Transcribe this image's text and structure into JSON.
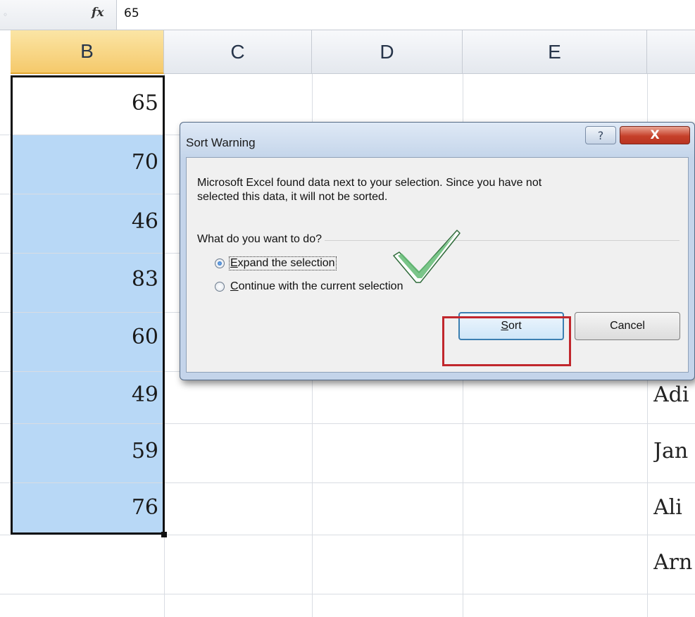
{
  "formula_bar": {
    "fx_label": "fx",
    "value": "65"
  },
  "columns": [
    "B",
    "C",
    "D",
    "E"
  ],
  "active_column": "B",
  "column_b_values": [
    "65",
    "70",
    "46",
    "83",
    "60",
    "49",
    "59",
    "76"
  ],
  "column_f_visible_text": [
    "Adi",
    "Jan",
    "Ali",
    "Arn"
  ],
  "dialog": {
    "title": "Sort Warning",
    "help_label": "?",
    "close_label": "X",
    "message_line1": "Microsoft Excel found data next to your selection.  Since you have not",
    "message_line2": "selected this data, it will not be sorted.",
    "group_label": "What do you want to do?",
    "option_expand": {
      "mnemonic": "E",
      "rest": "xpand the selection",
      "selected": true
    },
    "option_continue": {
      "mnemonic": "C",
      "rest": "ontinue with the current selection",
      "selected": false
    },
    "sort_button": {
      "mnemonic": "S",
      "rest": "ort"
    },
    "cancel_button": "Cancel"
  },
  "colors": {
    "selection_fill": "#b8d8f6",
    "active_header": "#f5c96b",
    "highlight_box": "#c1272d",
    "checkmark": "#3f9e58"
  }
}
